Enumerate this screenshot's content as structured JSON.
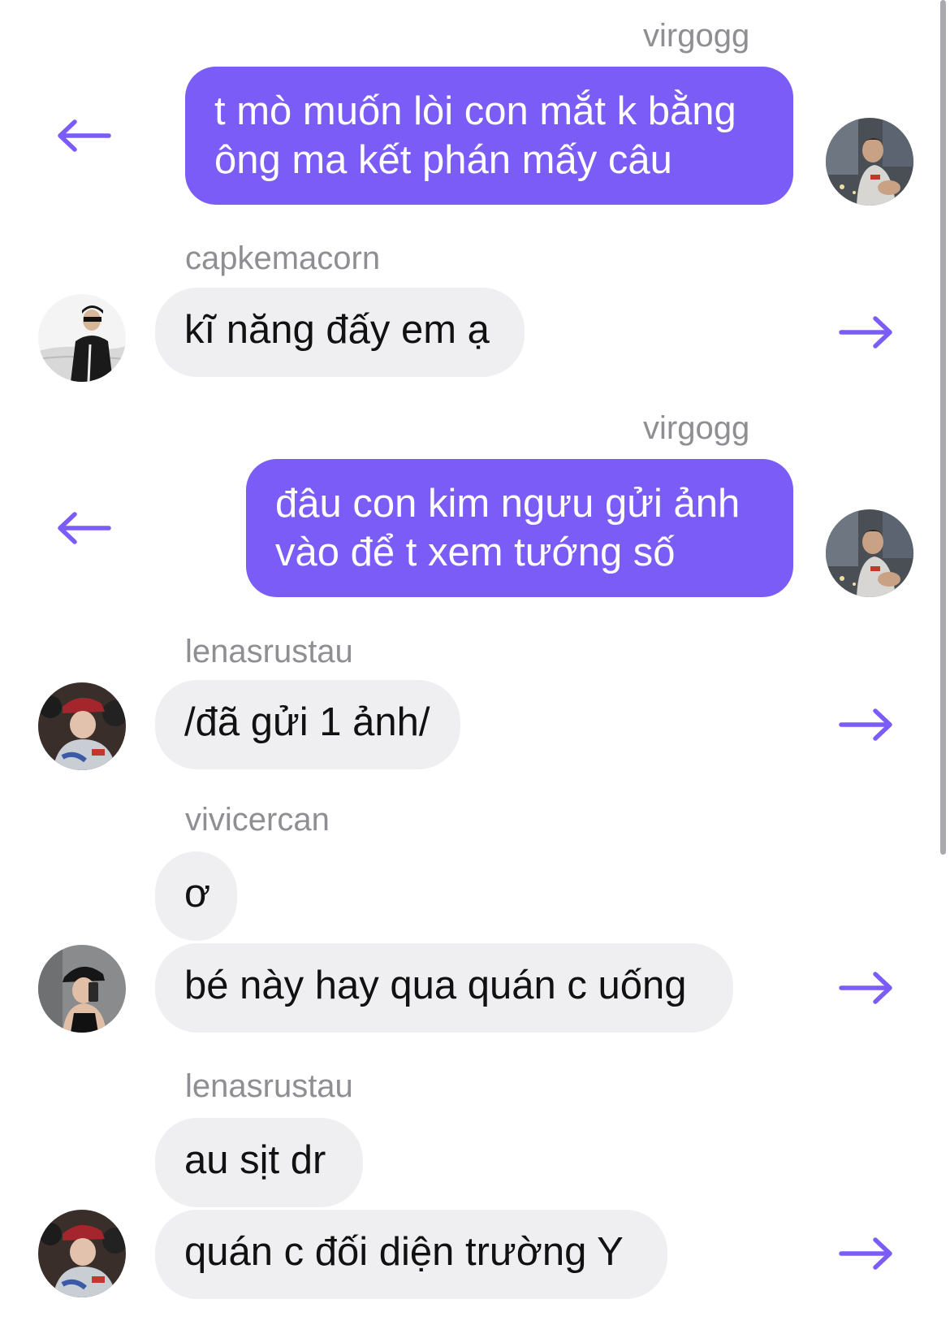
{
  "accent_color": "#7b5cf7",
  "messages": [
    {
      "sender": "virgogg",
      "text": "t mò muốn lòi con mắt k bằng\nông ma kết phán mấy câu",
      "direction": "outgoing"
    },
    {
      "sender": "capkemacorn",
      "text": "kĩ năng đấy em ạ",
      "direction": "incoming"
    },
    {
      "sender": "virgogg",
      "text": "đâu con kim ngưu gửi ảnh\nvào để t xem tướng số",
      "direction": "outgoing"
    },
    {
      "sender": "lenasrustau",
      "text": "/đã gửi 1 ảnh/",
      "direction": "incoming"
    },
    {
      "sender": "vivicercan",
      "texts": [
        "ơ",
        "bé này hay qua quán c uống"
      ],
      "direction": "incoming"
    },
    {
      "sender": "lenasrustau",
      "texts": [
        "au sịt dr",
        "quán c đối diện trường Y"
      ],
      "direction": "incoming"
    }
  ],
  "icons": {
    "reply_outgoing": "arrow-left-icon",
    "reply_incoming": "arrow-right-icon"
  }
}
